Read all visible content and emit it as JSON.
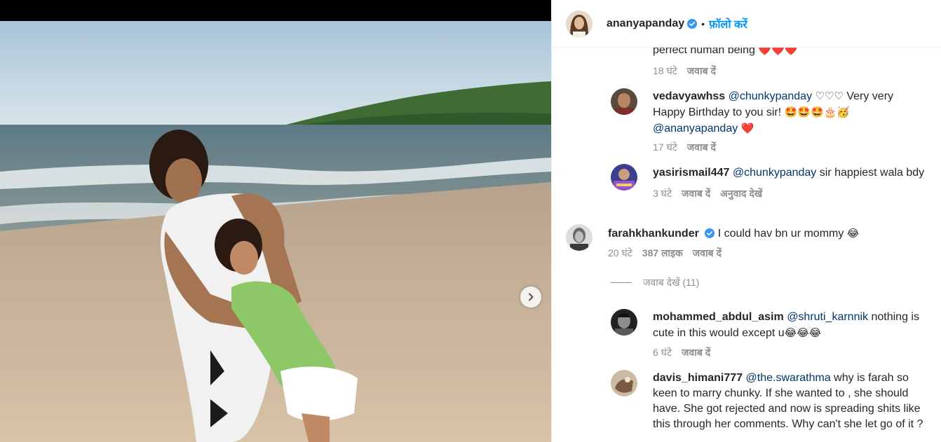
{
  "post": {
    "author": "ananyapanday",
    "follow_label": "फ़ॉलो करें",
    "separator": "•"
  },
  "comments": {
    "c0": {
      "text": "perfect human being",
      "emoji": "❤️❤️❤️",
      "time": "18 घंटे",
      "reply": "जवाब दें"
    },
    "c1": {
      "username": "vedavyawhss",
      "mention1": "@chunkypanday",
      "hearts": "♡♡♡",
      "text1": "Very very Happy Birthday to you sir!",
      "emoji1": "🤩🤩🤩🎂🥳",
      "mention2": "@ananyapanday",
      "emoji2": "❤️",
      "time": "17 घंटे",
      "reply": "जवाब दें"
    },
    "c2": {
      "username": "yasirismail447",
      "mention": "@chunkypanday",
      "text": "sir happiest wala bdy",
      "time": "3 घंटे",
      "reply": "जवाब दें",
      "translate": "अनुवाद देखें"
    },
    "c3": {
      "username": "farahkhankunder",
      "text": "I could hav bn ur mommy",
      "emoji": "😂",
      "time": "20 घंटे",
      "likes": "387 लाइक",
      "reply": "जवाब दें",
      "view_replies": "जवाब देखें (11)"
    },
    "c4": {
      "username": "mohammed_abdul_asim",
      "mention": "@shruti_karnnik",
      "text": "nothing is cute in this would except u",
      "emoji": "😂😂😂",
      "time": "6 घंटे",
      "reply": "जवाब दें"
    },
    "c5": {
      "username": "davis_himani777",
      "mention": "@the.swarathma",
      "text": "why is farah so keen to marry chunky. If she wanted to , she should have. She got rejected and now is spreading shits like this through her comments. Why can't she let go of it ?"
    }
  },
  "colors": {
    "link": "#0095f6",
    "mention": "#00376b",
    "secondary_text": "#8e8e8e",
    "verified": "#3897f0"
  },
  "icons": {
    "next": "chevron-right-icon",
    "verified": "verified-badge-icon"
  }
}
